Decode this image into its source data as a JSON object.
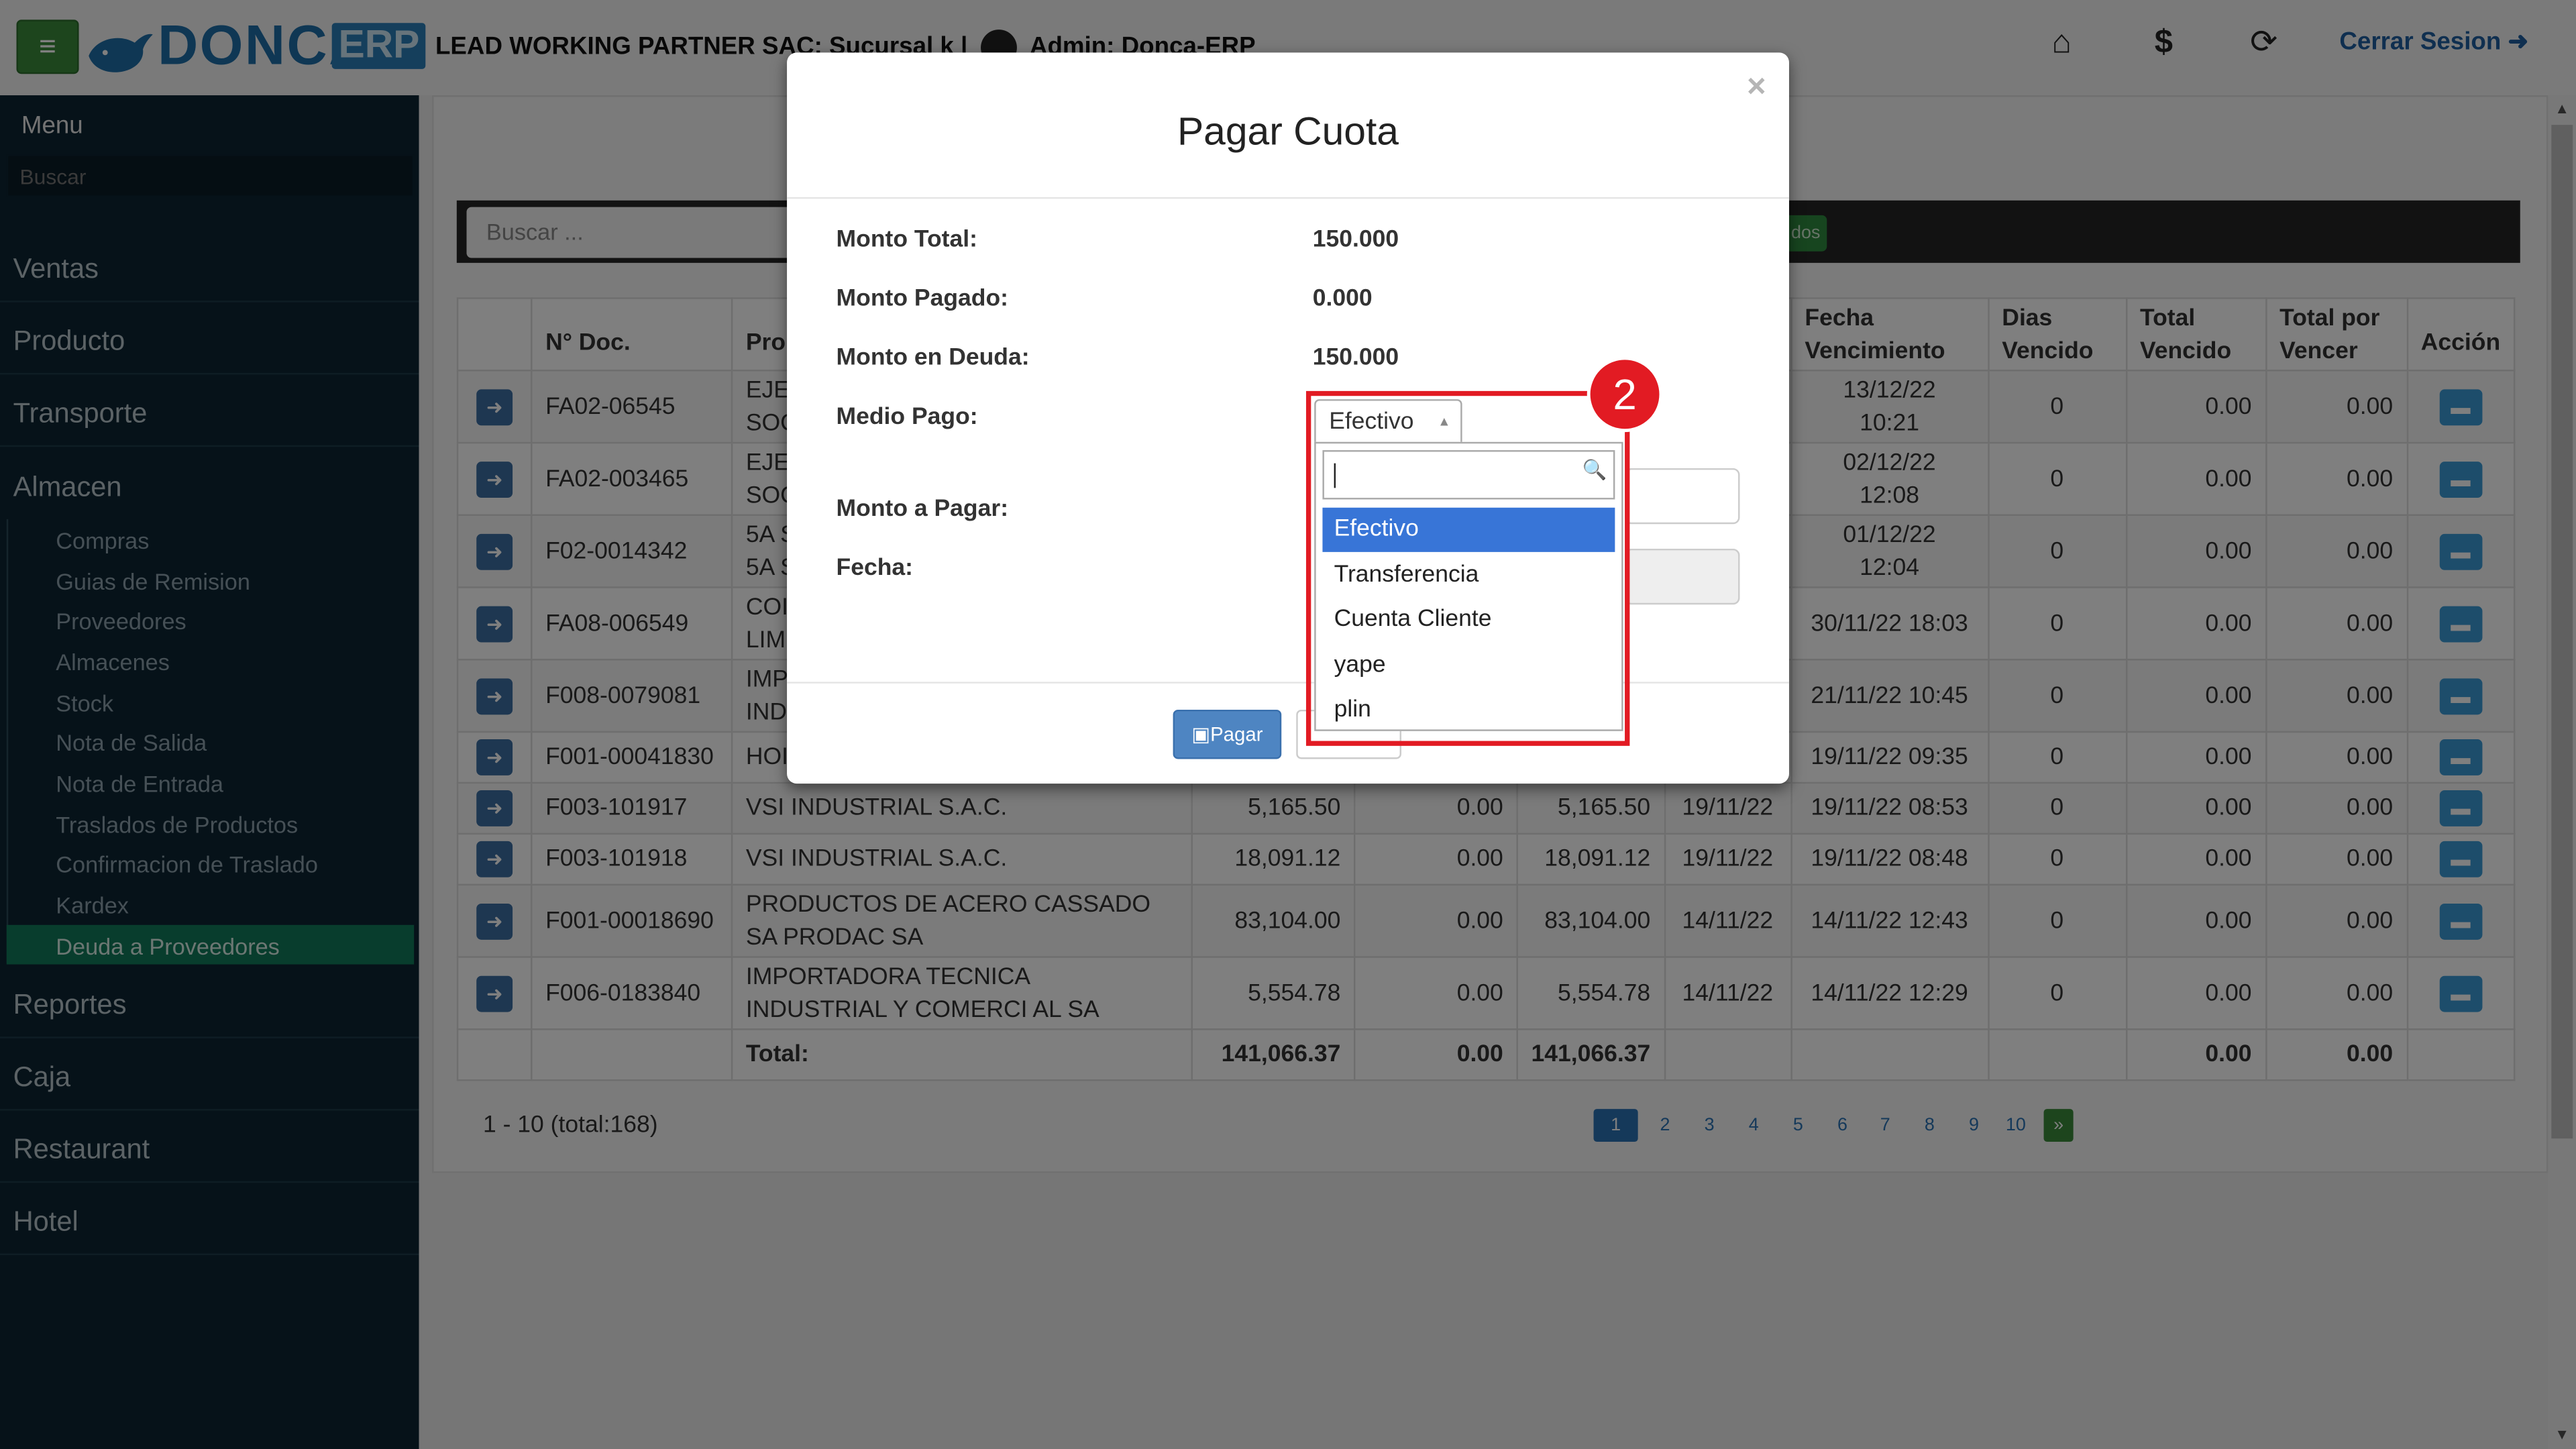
{
  "app": {
    "brand_name": "DONCA",
    "brand_suffix": "ERP",
    "company_line": "LEAD WORKING PARTNER SAC: Sucursal k |",
    "user_label": "Admin: Donca-ERP",
    "logout_label": "Cerrar Sesion",
    "menu_icon": "hamburger-icon",
    "top_icons": [
      "home-icon",
      "dollar-icon",
      "lock-rotate-icon"
    ]
  },
  "sidebar": {
    "title": "Menu",
    "search_placeholder": "Buscar",
    "main_items": [
      "Ventas",
      "Producto",
      "Transporte",
      "Almacen",
      "Reportes",
      "Caja",
      "Restaurant",
      "Hotel"
    ],
    "sub_items": [
      "Compras",
      "Guias de Remision",
      "Proveedores",
      "Almacenes",
      "Stock",
      "Nota de Salida",
      "Nota de Entrada",
      "Traslados de Productos",
      "Confirmacion de Traslado",
      "Kardex",
      "Deuda a Proveedores"
    ],
    "active_sub_item": "Deuda a Proveedores"
  },
  "toolbar": {
    "search_placeholder": "Buscar ...",
    "filter_button_fragment": "dos"
  },
  "table": {
    "headers": {
      "doc": "N° Doc.",
      "prov": "Pro",
      "fecha_venc_1": "Fecha",
      "fecha_venc_2": "Vencimiento",
      "dias_1": "Dias",
      "dias_2": "Vencido",
      "tot_venc_1": "Total",
      "tot_venc_2": "Vencido",
      "tot_por_1": "Total por",
      "tot_por_2": "Vencer",
      "accion": "Acción"
    },
    "rows": [
      {
        "doc": "FA02-06545",
        "prov_1": "EJE",
        "prov_2": "SOC",
        "monto": "",
        "pagado": "",
        "deuda": "",
        "fecha": "",
        "venc_1": "13/12/22",
        "venc_2": "10:21",
        "dias": "0",
        "tot_venc": "0.00",
        "tot_por": "0.00"
      },
      {
        "doc": "FA02-003465",
        "prov_1": "EJE",
        "prov_2": "SOC",
        "monto": "",
        "pagado": "",
        "deuda": "",
        "fecha": "",
        "venc_1": "02/12/22",
        "venc_2": "12:08",
        "dias": "0",
        "tot_venc": "0.00",
        "tot_por": "0.00"
      },
      {
        "doc": "F02-0014342",
        "prov_1": "5A S",
        "prov_2": "5A S",
        "monto": "",
        "pagado": "",
        "deuda": "",
        "fecha": "",
        "venc_1": "01/12/22",
        "venc_2": "12:04",
        "dias": "0",
        "tot_venc": "0.00",
        "tot_por": "0.00"
      },
      {
        "doc": "FA08-006549",
        "prov_1": "COI",
        "prov_2": "LIM",
        "monto": "",
        "pagado": "",
        "deuda": "",
        "fecha": "",
        "venc_1": "30/11/22 18:03",
        "venc_2": "",
        "dias": "0",
        "tot_venc": "0.00",
        "tot_por": "0.00"
      },
      {
        "doc": "F008-0079081",
        "prov_1": "IMP",
        "prov_2": "IND",
        "monto": "",
        "pagado": "",
        "deuda": "",
        "fecha": "",
        "venc_1": "21/11/22 10:45",
        "venc_2": "",
        "dias": "0",
        "tot_venc": "0.00",
        "tot_por": "0.00"
      },
      {
        "doc": "F001-00041830",
        "prov_1": "HOI",
        "prov_2": "",
        "monto": "",
        "pagado": "",
        "deuda": "",
        "fecha": "",
        "venc_1": "19/11/22 09:35",
        "venc_2": "",
        "dias": "0",
        "tot_venc": "0.00",
        "tot_por": "0.00"
      },
      {
        "doc": "F003-101917",
        "prov_1": "VSI INDUSTRIAL S.A.C.",
        "prov_2": "",
        "monto": "5,165.50",
        "pagado": "0.00",
        "deuda": "5,165.50",
        "fecha": "19/11/22",
        "venc_1": "19/11/22 08:53",
        "venc_2": "",
        "dias": "0",
        "tot_venc": "0.00",
        "tot_por": "0.00"
      },
      {
        "doc": "F003-101918",
        "prov_1": "VSI INDUSTRIAL S.A.C.",
        "prov_2": "",
        "monto": "18,091.12",
        "pagado": "0.00",
        "deuda": "18,091.12",
        "fecha": "19/11/22",
        "venc_1": "19/11/22 08:48",
        "venc_2": "",
        "dias": "0",
        "tot_venc": "0.00",
        "tot_por": "0.00"
      },
      {
        "doc": "F001-00018690",
        "prov_1": "PRODUCTOS DE ACERO CASSADO",
        "prov_2": "SA PRODAC SA",
        "monto": "83,104.00",
        "pagado": "0.00",
        "deuda": "83,104.00",
        "fecha": "14/11/22",
        "venc_1": "14/11/22 12:43",
        "venc_2": "",
        "dias": "0",
        "tot_venc": "0.00",
        "tot_por": "0.00"
      },
      {
        "doc": "F006-0183840",
        "prov_1": "IMPORTADORA TECNICA",
        "prov_2": "INDUSTRIAL Y COMERCI AL SA",
        "monto": "5,554.78",
        "pagado": "0.00",
        "deuda": "5,554.78",
        "fecha": "14/11/22",
        "venc_1": "14/11/22 12:29",
        "venc_2": "",
        "dias": "0",
        "tot_venc": "0.00",
        "tot_por": "0.00"
      }
    ],
    "totals": {
      "label": "Total:",
      "monto": "141,066.37",
      "pagado": "0.00",
      "deuda": "141,066.37",
      "tot_venc": "0.00",
      "tot_por": "0.00"
    }
  },
  "pagination": {
    "summary": "1 - 10 (total:168)",
    "pages": [
      "1",
      "2",
      "3",
      "4",
      "5",
      "6",
      "7",
      "8",
      "9",
      "10"
    ],
    "current": "1",
    "next": "»"
  },
  "modal": {
    "title": "Pagar Cuota",
    "close": "×",
    "fields": [
      {
        "label": "Monto Total:",
        "value": "150.000"
      },
      {
        "label": "Monto Pagado:",
        "value": "0.000"
      },
      {
        "label": "Monto en Deuda:",
        "value": "150.000"
      }
    ],
    "medio_pago_label": "Medio Pago:",
    "monto_pagar_label": "Monto a Pagar:",
    "fecha_label": "Fecha:",
    "pay_button": "Pagar",
    "select": {
      "selected": "Efectivo",
      "search_value": "",
      "options": [
        "Efectivo",
        "Transferencia",
        "Cuenta Cliente",
        "yape",
        "plin"
      ],
      "highlighted": "Efectivo"
    }
  },
  "annotation": {
    "badge_number": "2",
    "color": "#e21b23"
  }
}
